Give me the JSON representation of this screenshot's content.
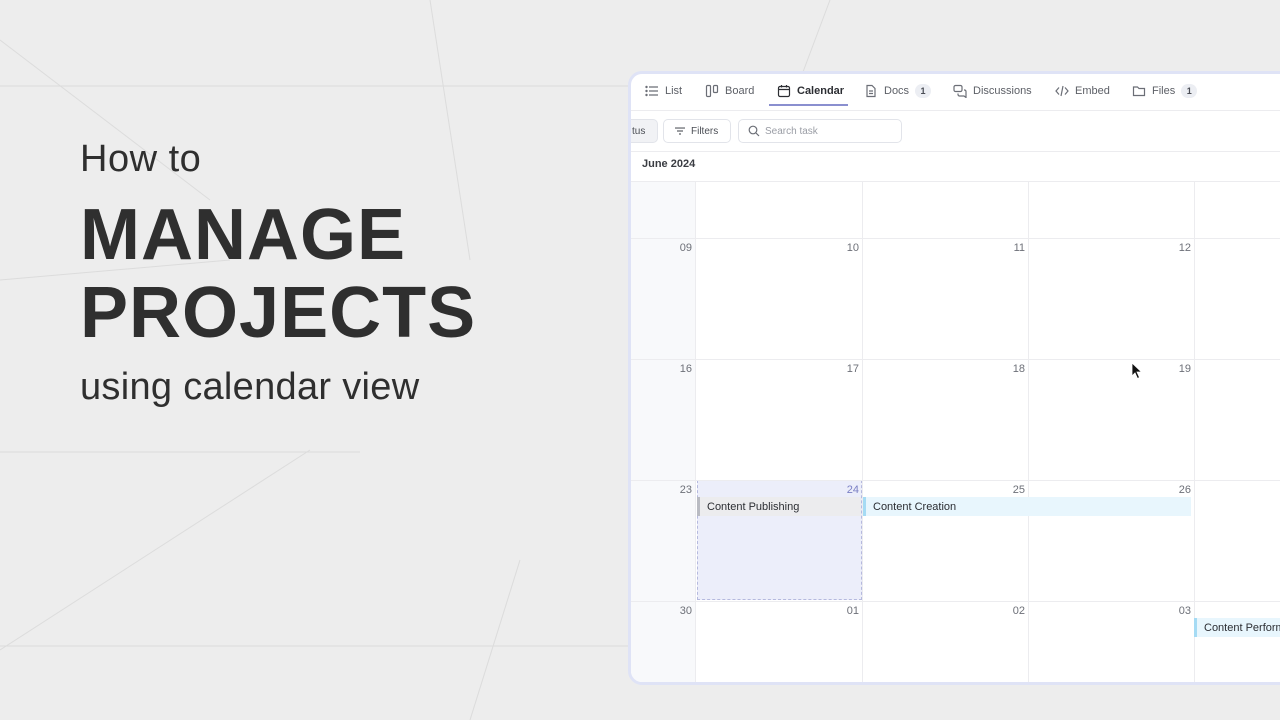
{
  "headline": {
    "line1": "How to",
    "line2": "MANAGE",
    "line3": "PROJECTS",
    "line4": "using calendar view"
  },
  "tabs": [
    {
      "label": "List",
      "icon": "list-icon"
    },
    {
      "label": "Board",
      "icon": "board-icon"
    },
    {
      "label": "Calendar",
      "icon": "calendar-icon",
      "active": true
    },
    {
      "label": "Docs",
      "icon": "doc-icon",
      "badge": "1"
    },
    {
      "label": "Discussions",
      "icon": "discussions-icon"
    },
    {
      "label": "Embed",
      "icon": "code-icon"
    },
    {
      "label": "Files",
      "icon": "folder-icon",
      "badge": "1"
    }
  ],
  "toolbar": {
    "status_label": "tus",
    "filters_label": "Filters",
    "search_placeholder": "Search task"
  },
  "calendar": {
    "month": "June 2024",
    "weeks": [
      {
        "days": [
          "",
          "",
          "",
          "",
          ""
        ]
      },
      {
        "days": [
          "09",
          "10",
          "11",
          "12",
          ""
        ]
      },
      {
        "days": [
          "16",
          "17",
          "18",
          "19",
          ""
        ]
      },
      {
        "days": [
          "23",
          "24",
          "25",
          "26",
          ""
        ]
      },
      {
        "days": [
          "30",
          "01",
          "02",
          "03",
          ""
        ]
      }
    ],
    "highlighted_day": "24",
    "events": [
      {
        "title": "Content Publishing"
      },
      {
        "title": "Content Creation"
      },
      {
        "title": "Content Perform"
      }
    ]
  },
  "colors": {
    "accent": "#8a8fcf",
    "highlight": "#eceefa",
    "event_blue": "#e8f6fd",
    "event_gray": "#ececee"
  }
}
